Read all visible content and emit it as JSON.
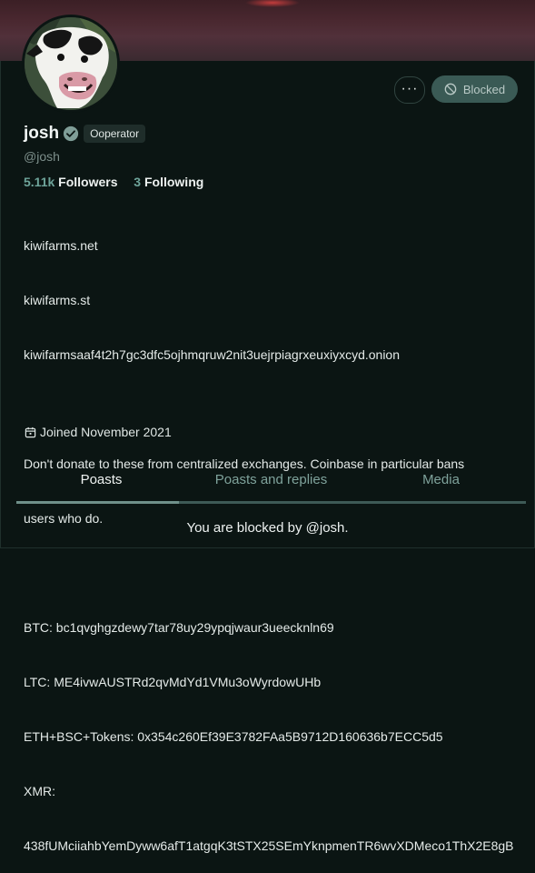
{
  "profile": {
    "display_name": "josh",
    "role_badge": "Ooperator",
    "handle": "@josh",
    "avatar_caption": "Moo",
    "followers_count": "5.11k",
    "followers_label": "Followers",
    "following_count": "3",
    "following_label": "Following",
    "bio_lines": [
      "kiwifarms.net",
      "kiwifarms.st",
      "kiwifarmsaaf4t2h7gc3dfc5ojhmqruw2nit3uejrpiagrxeuxiyxcyd.onion",
      "",
      "Don't donate to these from centralized exchanges. Coinbase in particular bans",
      "users who do.",
      "",
      "BTC: bc1qvghgzdewy7tar78uy29ypqjwaur3ueecknln69",
      "LTC: ME4ivwAUSTRd2qvMdYd1VMu3oWyrdowUHb",
      "ETH+BSC+Tokens: 0x354c260Ef39E3782FAa5B9712D160636b7ECC5d5",
      "XMR:",
      "438fUMciiahbYemDyww6afT1atgqK3tSTX25SEmYknpmenTR6wvXDMeco1ThX2E8gB"
    ],
    "joined": "Joined November 2021"
  },
  "actions": {
    "more_label": "···",
    "blocked_label": "Blocked"
  },
  "tabs": [
    {
      "label": "Poasts",
      "active": true
    },
    {
      "label": "Poasts and replies",
      "active": false
    },
    {
      "label": "Media",
      "active": false
    }
  ],
  "blocked_message": "You are blocked by @josh.",
  "colors": {
    "background": "#0b1513",
    "accent": "#6ea49a",
    "blocked_button": "#3a5a55"
  }
}
